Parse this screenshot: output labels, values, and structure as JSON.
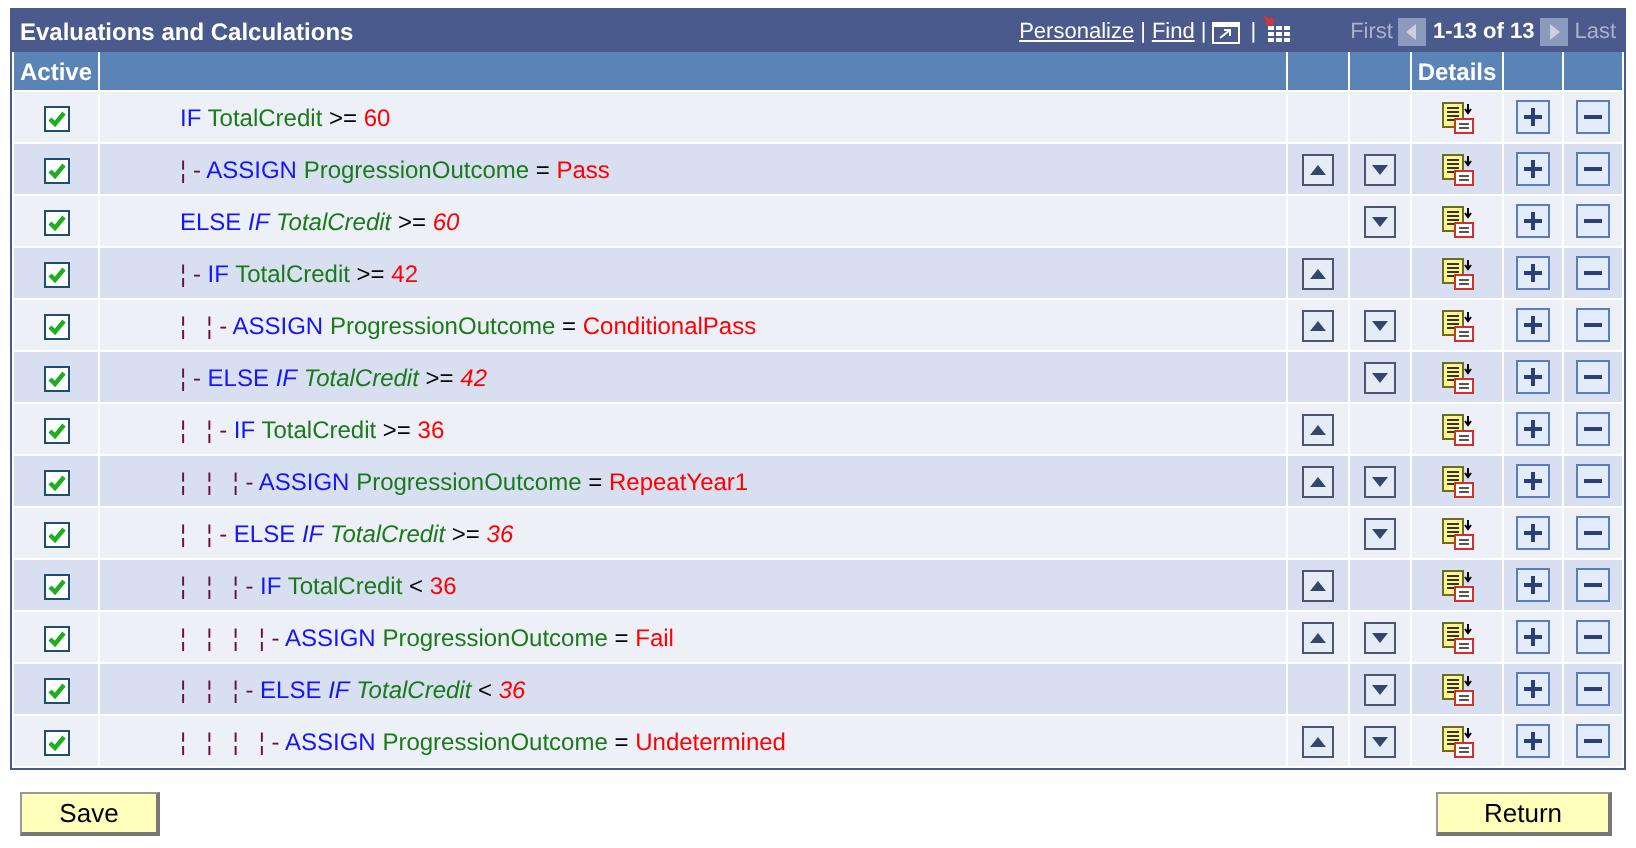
{
  "grid": {
    "title": "Evaluations and Calculations",
    "toolbar": [
      {
        "kind": "link",
        "text": "Personalize"
      },
      {
        "kind": "separator",
        "text": "|"
      },
      {
        "kind": "link",
        "text": "Find"
      },
      {
        "kind": "separator",
        "text": "|"
      },
      {
        "kind": "window"
      },
      {
        "kind": "separator",
        "text": "|"
      },
      {
        "kind": "download"
      }
    ],
    "pager": {
      "first": "First",
      "range": "1-13 of 13",
      "last": "Last"
    },
    "columns": [
      "Active",
      "Details"
    ],
    "rows": [
      {
        "active": true,
        "prefix": "",
        "tokens": [
          {
            "kind": "keyword",
            "text": "IF"
          },
          {
            "kind": "field",
            "text": "TotalCredit"
          },
          {
            "kind": "op",
            "text": ">="
          },
          {
            "kind": "value",
            "text": "60"
          }
        ],
        "up": false,
        "down": false
      },
      {
        "active": true,
        "prefix": "¦ -",
        "tokens": [
          {
            "kind": "keyword",
            "text": "ASSIGN"
          },
          {
            "kind": "field",
            "text": "ProgressionOutcome"
          },
          {
            "kind": "op",
            "text": "="
          },
          {
            "kind": "value",
            "text": "Pass"
          }
        ],
        "up": true,
        "down": true
      },
      {
        "active": true,
        "prefix": "",
        "tokens": [
          {
            "kind": "keyword",
            "text": "ELSE"
          },
          {
            "kind": "keyword",
            "text": "IF",
            "italic": true
          },
          {
            "kind": "field",
            "text": "TotalCredit",
            "italic": true
          },
          {
            "kind": "op",
            "text": ">="
          },
          {
            "kind": "value",
            "text": "60",
            "italic": true
          }
        ],
        "up": false,
        "down": true
      },
      {
        "active": true,
        "prefix": "¦ -",
        "tokens": [
          {
            "kind": "keyword",
            "text": "IF"
          },
          {
            "kind": "field",
            "text": "TotalCredit"
          },
          {
            "kind": "op",
            "text": ">="
          },
          {
            "kind": "value",
            "text": "42"
          }
        ],
        "up": true,
        "down": false
      },
      {
        "active": true,
        "prefix": "¦   ¦ -",
        "tokens": [
          {
            "kind": "keyword",
            "text": "ASSIGN"
          },
          {
            "kind": "field",
            "text": "ProgressionOutcome"
          },
          {
            "kind": "op",
            "text": "="
          },
          {
            "kind": "value",
            "text": "ConditionalPass"
          }
        ],
        "up": true,
        "down": true
      },
      {
        "active": true,
        "prefix": "¦ -",
        "tokens": [
          {
            "kind": "keyword",
            "text": "ELSE"
          },
          {
            "kind": "keyword",
            "text": "IF",
            "italic": true
          },
          {
            "kind": "field",
            "text": "TotalCredit",
            "italic": true
          },
          {
            "kind": "op",
            "text": ">="
          },
          {
            "kind": "value",
            "text": "42",
            "italic": true
          }
        ],
        "up": false,
        "down": true
      },
      {
        "active": true,
        "prefix": "¦   ¦ -",
        "tokens": [
          {
            "kind": "keyword",
            "text": "IF"
          },
          {
            "kind": "field",
            "text": "TotalCredit"
          },
          {
            "kind": "op",
            "text": ">="
          },
          {
            "kind": "value",
            "text": "36"
          }
        ],
        "up": true,
        "down": false
      },
      {
        "active": true,
        "prefix": "¦   ¦   ¦ -",
        "tokens": [
          {
            "kind": "keyword",
            "text": "ASSIGN"
          },
          {
            "kind": "field",
            "text": "ProgressionOutcome"
          },
          {
            "kind": "op",
            "text": "="
          },
          {
            "kind": "value",
            "text": "RepeatYear1"
          }
        ],
        "up": true,
        "down": true
      },
      {
        "active": true,
        "prefix": "¦   ¦ -",
        "tokens": [
          {
            "kind": "keyword",
            "text": "ELSE"
          },
          {
            "kind": "keyword",
            "text": "IF",
            "italic": true
          },
          {
            "kind": "field",
            "text": "TotalCredit",
            "italic": true
          },
          {
            "kind": "op",
            "text": ">="
          },
          {
            "kind": "value",
            "text": "36",
            "italic": true
          }
        ],
        "up": false,
        "down": true
      },
      {
        "active": true,
        "prefix": "¦   ¦   ¦ -",
        "tokens": [
          {
            "kind": "keyword",
            "text": "IF"
          },
          {
            "kind": "field",
            "text": "TotalCredit"
          },
          {
            "kind": "op",
            "text": "<"
          },
          {
            "kind": "value",
            "text": "36"
          }
        ],
        "up": true,
        "down": false
      },
      {
        "active": true,
        "prefix": "¦   ¦   ¦   ¦ -",
        "tokens": [
          {
            "kind": "keyword",
            "text": "ASSIGN"
          },
          {
            "kind": "field",
            "text": "ProgressionOutcome"
          },
          {
            "kind": "op",
            "text": "="
          },
          {
            "kind": "value",
            "text": "Fail"
          }
        ],
        "up": true,
        "down": true
      },
      {
        "active": true,
        "prefix": "¦   ¦   ¦ -",
        "tokens": [
          {
            "kind": "keyword",
            "text": "ELSE"
          },
          {
            "kind": "keyword",
            "text": "IF",
            "italic": true
          },
          {
            "kind": "field",
            "text": "TotalCredit",
            "italic": true
          },
          {
            "kind": "op",
            "text": "<"
          },
          {
            "kind": "value",
            "text": "36",
            "italic": true
          }
        ],
        "up": false,
        "down": true
      },
      {
        "active": true,
        "prefix": "¦   ¦   ¦   ¦ -",
        "tokens": [
          {
            "kind": "keyword",
            "text": "ASSIGN"
          },
          {
            "kind": "field",
            "text": "ProgressionOutcome"
          },
          {
            "kind": "op",
            "text": "="
          },
          {
            "kind": "value",
            "text": "Undetermined"
          }
        ],
        "up": true,
        "down": true
      }
    ]
  },
  "buttons": [
    {
      "label": "Save"
    },
    {
      "label": "Return"
    }
  ]
}
